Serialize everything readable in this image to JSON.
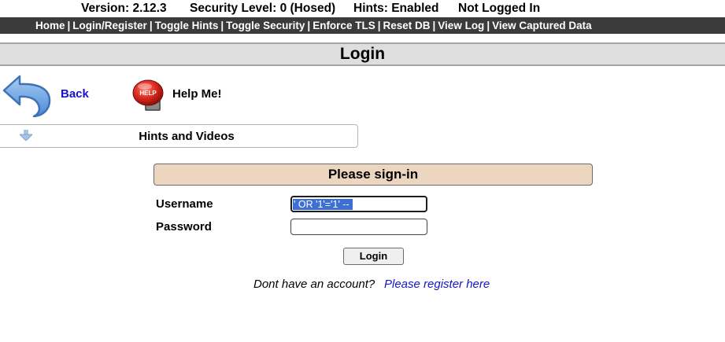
{
  "status": {
    "version": "Version: 2.12.3",
    "security_level": "Security Level: 0 (Hosed)",
    "hints": "Hints: Enabled",
    "login_state": "Not Logged In"
  },
  "nav": {
    "items": [
      "Home",
      "Login/Register",
      "Toggle Hints",
      "Toggle Security",
      "Enforce TLS",
      "Reset DB",
      "View Log",
      "View Captured Data"
    ],
    "separator": "|"
  },
  "page_title": "Login",
  "back_label": "Back",
  "help_label": "Help Me!",
  "help_icon_text": "HELP",
  "hints_label": "Hints and Videos",
  "form": {
    "header": "Please sign-in",
    "username_label": "Username",
    "username_value": "' OR '1'='1' --",
    "password_label": "Password",
    "password_value": "",
    "login_button": "Login"
  },
  "register": {
    "prompt": "Dont have an account?",
    "link": "Please register here"
  },
  "colors": {
    "nav_bg": "#3b3b3b",
    "title_bg": "#dedede",
    "signin_header_bg": "#edd6c0",
    "link": "#1515c7",
    "selection": "#3d6fd4"
  }
}
